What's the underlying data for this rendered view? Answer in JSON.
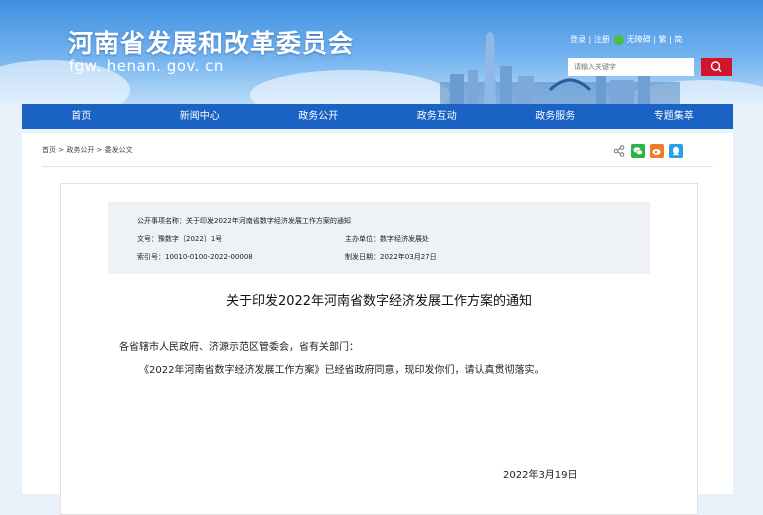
{
  "header": {
    "title": "河南省发展和改革委员会",
    "domain": "fgw. henan. gov. cn",
    "links": {
      "login": "登录",
      "sep1": " | ",
      "register": "注册",
      "accessible": "无障碍",
      "sep2": " | ",
      "traditional": "繁",
      "sep3": " | ",
      "simplified": "简"
    },
    "search_placeholder": "请输入关键字",
    "search_button_color": "#d1152c"
  },
  "nav": [
    "首页",
    "新闻中心",
    "政务公开",
    "政务互动",
    "政务服务",
    "专题集萃"
  ],
  "breadcrumb": "首页 > 政务公开 > 委发公文",
  "share_icons": [
    "share-icon",
    "wechat-icon",
    "weibo-icon",
    "qq-icon"
  ],
  "meta": {
    "item": "公开事项名称：关于印发2022年河南省数字经济发展工作方案的通知",
    "doc_no": "文号：豫数字〔2022〕1号",
    "unit": "主办单位：数字经济发展处",
    "index": "索引号：10010-0100-2022-00008",
    "date": "制发日期：2022年03月27日"
  },
  "doc": {
    "title": "关于印发2022年河南省数字经济发展工作方案的通知",
    "para1": "各省辖市人民政府、济源示范区管委会，省有关部门：",
    "para2": "《2022年河南省数字经济发展工作方案》已经省政府同意，现印发你们，请认真贯彻落实。",
    "date": "2022年3月19日"
  }
}
